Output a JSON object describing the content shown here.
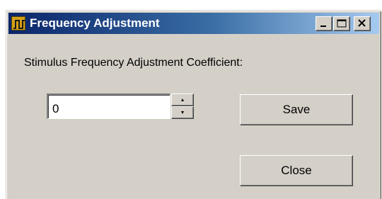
{
  "window": {
    "title": "Frequency Adjustment",
    "icon": "waveform-icon",
    "controls": {
      "minimize_icon": "minimize-icon",
      "maximize_icon": "maximize-icon",
      "close_icon": "close-x-icon"
    },
    "titlebar_colors": [
      "#0a246a",
      "#a6caf0"
    ],
    "face_color": "#d4d0c8"
  },
  "form": {
    "coefficient_label": "Stimulus Frequency Adjustment Coefficient:",
    "coefficient_value": "0",
    "spin_up_icon": "arrow-up-icon",
    "spin_down_icon": "arrow-down-icon"
  },
  "buttons": {
    "save_label": "Save",
    "close_label": "Close"
  }
}
